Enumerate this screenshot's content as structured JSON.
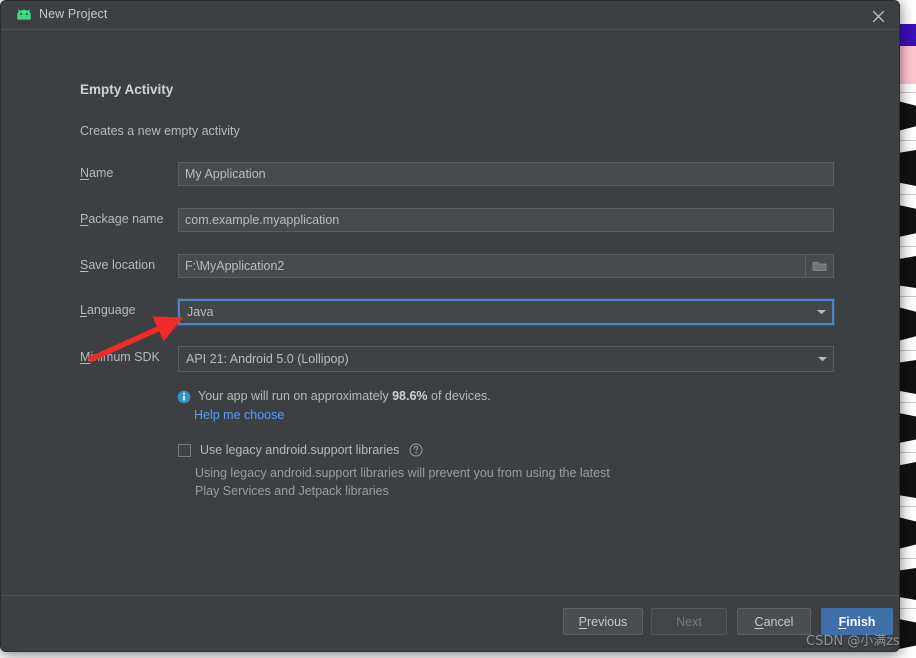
{
  "window": {
    "title": "New Project",
    "icon": "android-robot-icon",
    "close_icon": "close-icon"
  },
  "page": {
    "title": "Empty Activity",
    "subtitle": "Creates a new empty activity"
  },
  "form": {
    "fields": [
      {
        "id": "name",
        "label": "Name",
        "mnemonic": "N",
        "value": "My Application",
        "type": "text"
      },
      {
        "id": "package-name",
        "label": "Package name",
        "mnemonic": "P",
        "value": "com.example.myapplication",
        "type": "text"
      },
      {
        "id": "save-location",
        "label": "Save location",
        "mnemonic": "S",
        "value": "F:\\MyApplication2",
        "type": "text-with-browse",
        "browse_icon": "folder-icon"
      },
      {
        "id": "language",
        "label": "Language",
        "mnemonic": "L",
        "value": "Java",
        "type": "dropdown",
        "focused": true,
        "arrow_icon": "chevron-down-icon"
      },
      {
        "id": "minimum-sdk",
        "label": "Minimum SDK",
        "mnemonic": "M",
        "value": "API 21: Android 5.0 (Lollipop)",
        "type": "dropdown",
        "focused": false,
        "arrow_icon": "chevron-down-icon"
      }
    ]
  },
  "info": {
    "icon": "info-icon",
    "text_before": "Your app will run on approximately ",
    "percent": "98.6%",
    "text_after": " of devices.",
    "link": "Help me choose"
  },
  "legacy": {
    "checkbox_label": "Use legacy android.support libraries",
    "checked": false,
    "help_icon": "question-mark-icon",
    "description": "Using legacy android.support libraries will prevent you from using the latest Play Services and Jetpack libraries"
  },
  "footer": {
    "buttons": [
      {
        "id": "previous",
        "label": "Previous",
        "mnemonic": "P",
        "state": "enabled"
      },
      {
        "id": "next",
        "label": "Next",
        "mnemonic": "",
        "state": "disabled"
      },
      {
        "id": "cancel",
        "label": "Cancel",
        "mnemonic": "C",
        "state": "enabled"
      },
      {
        "id": "finish",
        "label": "Finish",
        "mnemonic": "F",
        "state": "primary"
      }
    ]
  },
  "annotation": {
    "type": "red-arrow",
    "color": "#f12a2a",
    "points_to": "language-dropdown"
  },
  "watermark": {
    "text": "CSDN @小满zs"
  },
  "colors": {
    "dialog_background": "#3c4043",
    "field_background": "#474b4d",
    "focus_border": "#4b87c7",
    "primary_button": "#3f6fa8",
    "link": "#589df6",
    "text": "#b6babd",
    "android_green": "#3ddc84"
  }
}
